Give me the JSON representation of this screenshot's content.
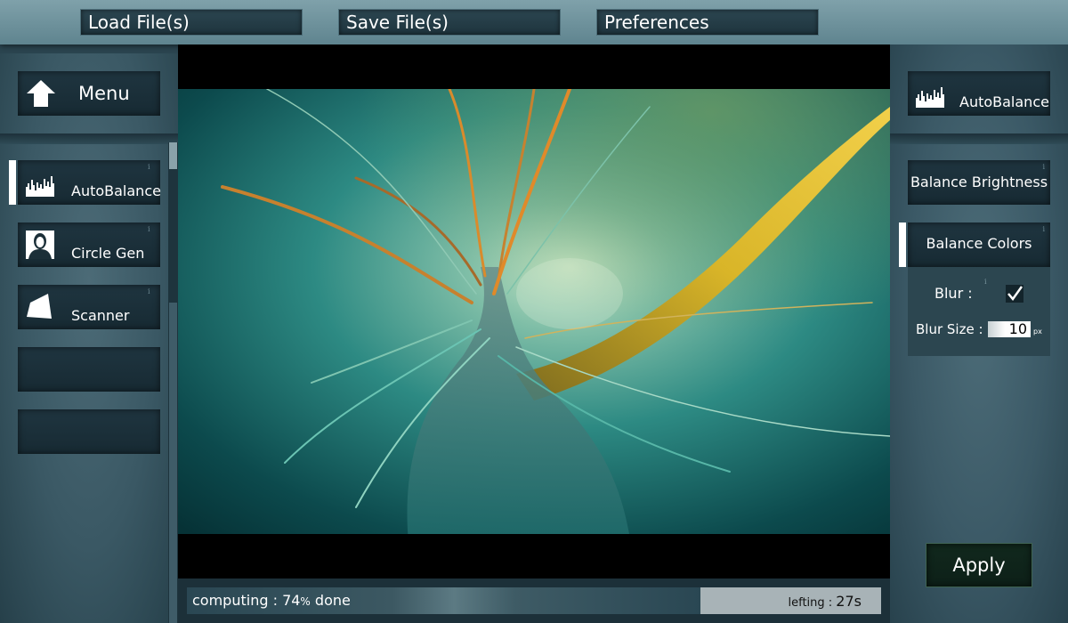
{
  "topbar": {
    "load_label": "Load File(s)",
    "save_label": "Save File(s)",
    "prefs_label": "Preferences"
  },
  "left": {
    "menu_label": "Menu",
    "tools": [
      {
        "label": "AutoBalance",
        "icon": "histogram-icon",
        "active": true
      },
      {
        "label": "Circle Gen",
        "icon": "portrait-icon",
        "active": false
      },
      {
        "label": "Scanner",
        "icon": "trapezoid-icon",
        "active": false
      },
      {
        "label": "",
        "icon": "",
        "active": false
      },
      {
        "label": "",
        "icon": "",
        "active": false
      }
    ],
    "info_glyph": "i"
  },
  "status": {
    "computing_prefix": "computing :",
    "percent_value": "74",
    "percent_sign": "%",
    "done_suffix": "done",
    "progress": 0.74,
    "remaining_label": "lefting :",
    "remaining_value": "27s"
  },
  "right": {
    "title": "AutoBalance",
    "title_icon": "histogram-icon",
    "balance_brightness": "Balance Brightness",
    "balance_colors": "Balance Colors",
    "blur_label": "Blur :",
    "blur_checked": true,
    "blur_size_label": "Blur Size :",
    "blur_size_value": "10",
    "blur_size_unit": "px",
    "apply_label": "Apply"
  },
  "colors": {
    "accent_white": "#ffffff",
    "panel_dark": "#1c323c",
    "apply_green": "#11281d"
  }
}
